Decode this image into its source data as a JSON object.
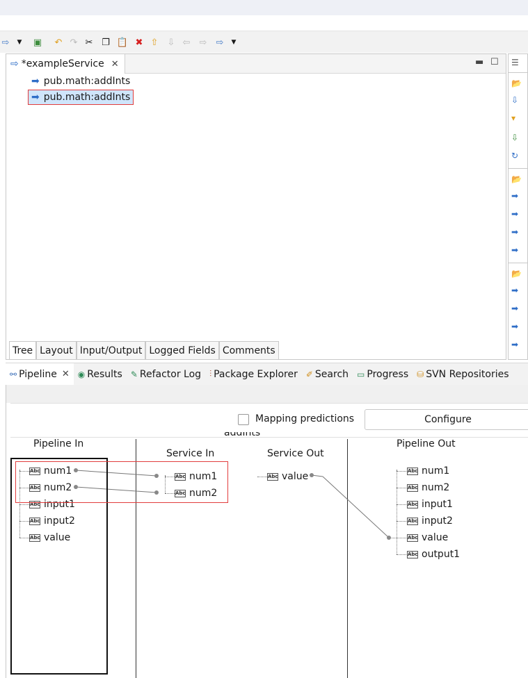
{
  "editor": {
    "tab_title": "*exampleService",
    "tree_items": [
      {
        "label": "pub.math:addInts"
      },
      {
        "label": "pub.math:addInts"
      }
    ],
    "bottom_tabs": [
      "Tree",
      "Layout",
      "Input/Output",
      "Logged Fields",
      "Comments"
    ]
  },
  "lower_tabs": [
    {
      "label": "Pipeline",
      "icon": "pipeline-icon"
    },
    {
      "label": "Results",
      "icon": "results-icon"
    },
    {
      "label": "Refactor Log",
      "icon": "refactor-log-icon"
    },
    {
      "label": "Package Explorer",
      "icon": "package-explorer-icon"
    },
    {
      "label": "Search",
      "icon": "search-icon"
    },
    {
      "label": "Progress",
      "icon": "progress-icon"
    },
    {
      "label": "SVN Repositories",
      "icon": "svn-repositories-icon"
    }
  ],
  "pipeline": {
    "mapping_predictions_label": "Mapping predictions",
    "configure_label": "Configure",
    "service_name_partial": "addInts",
    "columns": {
      "pipeline_in": "Pipeline In",
      "service_in": "Service In",
      "service_out": "Service Out",
      "pipeline_out": "Pipeline Out"
    },
    "pipeline_in_vars": [
      "num1",
      "num2",
      "input1",
      "input2",
      "value"
    ],
    "service_in_vars": [
      "num1",
      "num2"
    ],
    "service_out_vars": [
      "value"
    ],
    "pipeline_out_vars": [
      "num1",
      "num2",
      "input1",
      "input2",
      "value",
      "output1"
    ],
    "abc_icon_text": "Abc"
  },
  "colors": {
    "highlight_red": "#e23c3c",
    "selection_blue": "#cfe5fb",
    "link_gray": "#777777"
  }
}
